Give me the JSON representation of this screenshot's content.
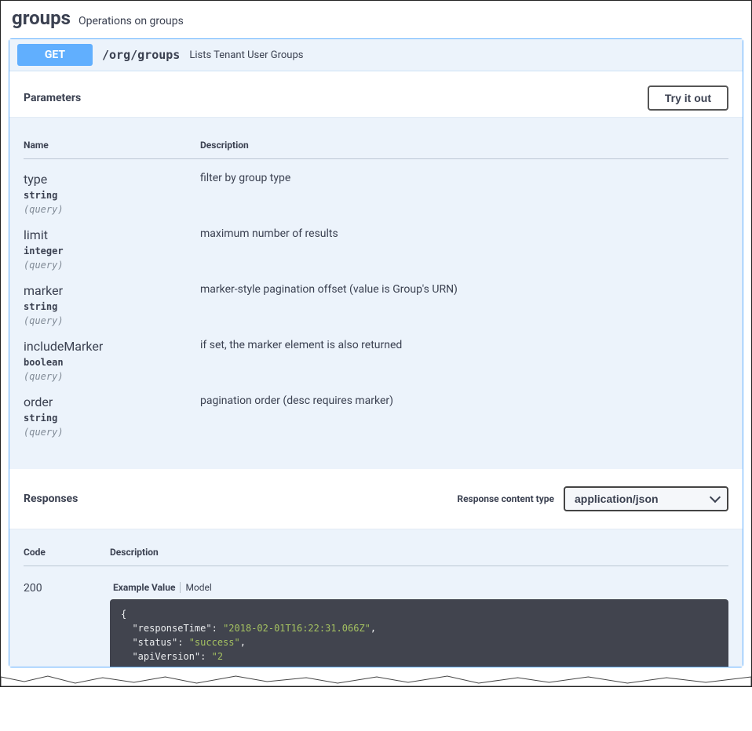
{
  "tag": {
    "name": "groups",
    "description": "Operations on groups"
  },
  "operation": {
    "method": "GET",
    "path": "/org/groups",
    "summary": "Lists Tenant User Groups"
  },
  "sections": {
    "parameters_title": "Parameters",
    "responses_title": "Responses",
    "try_button": "Try it out",
    "rct_label": "Response content type",
    "rct_value": "application/json"
  },
  "param_columns": {
    "name": "Name",
    "description": "Description"
  },
  "response_columns": {
    "code": "Code",
    "description": "Description"
  },
  "model_tabs": {
    "example": "Example Value",
    "model": "Model"
  },
  "parameters": [
    {
      "name": "type",
      "type": "string",
      "in": "(query)",
      "description": "filter by group type"
    },
    {
      "name": "limit",
      "type": "integer",
      "in": "(query)",
      "description": "maximum number of results"
    },
    {
      "name": "marker",
      "type": "string",
      "in": "(query)",
      "description": "marker-style pagination offset (value is Group's URN)"
    },
    {
      "name": "includeMarker",
      "type": "boolean",
      "in": "(query)",
      "description": "if set, the marker element is also returned"
    },
    {
      "name": "order",
      "type": "string",
      "in": "(query)",
      "description": "pagination order (desc requires marker)"
    }
  ],
  "responses": [
    {
      "code": "200"
    }
  ],
  "example_body": {
    "line0": "{",
    "k1": "\"responseTime\"",
    "v1": "\"2018-02-01T16:22:31.066Z\"",
    "k2": "\"status\"",
    "v2": "\"success\"",
    "k3": "\"apiVersion\"",
    "v3": "\"2"
  }
}
